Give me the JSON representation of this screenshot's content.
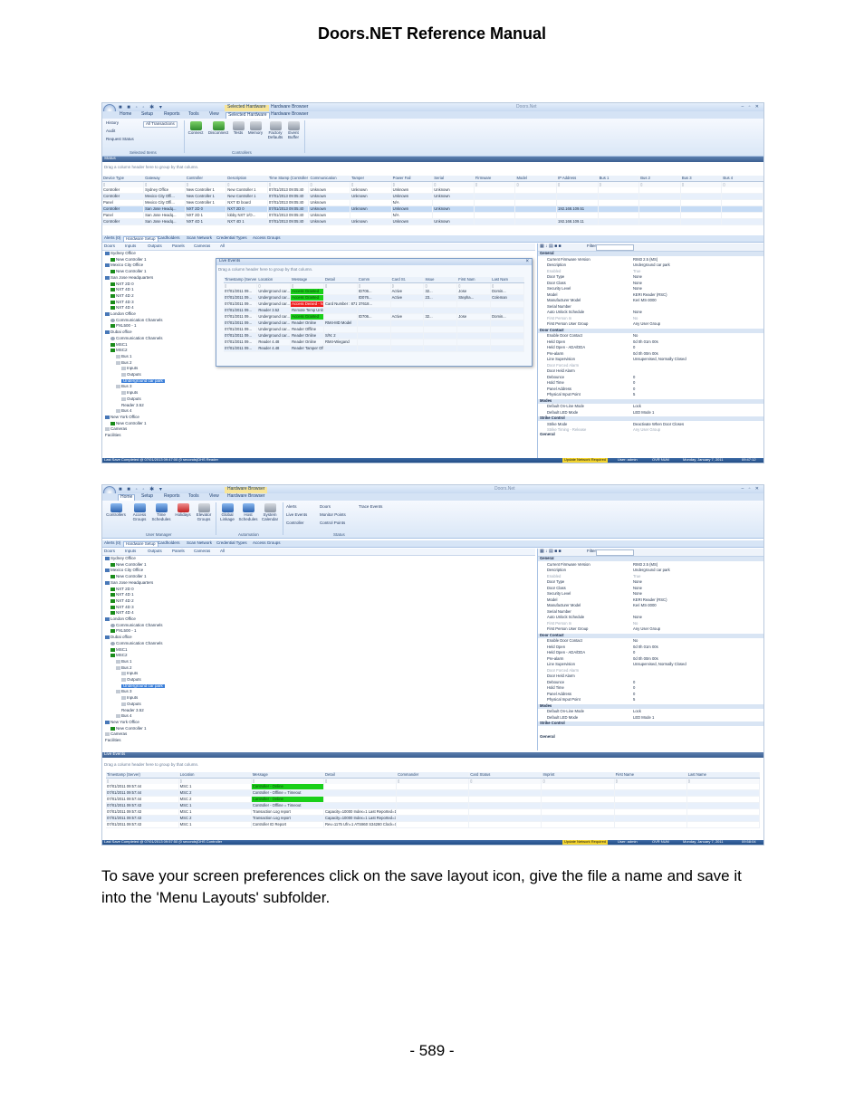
{
  "header": {
    "title": "Doors.NET Reference Manual"
  },
  "caption": "To save your screen preferences click on the save layout icon, give the file a name and save it into the 'Menu Layouts' subfolder.",
  "page_number": "- 589 -",
  "colors": {
    "ribbon_blue": "#d5e3f5",
    "status_blue": "#2c5a95",
    "alarm_green": "#19d019",
    "alarm_red": "#ef1c1c",
    "status_yellow": "#f2d32e"
  },
  "shot1": {
    "titlebar": {
      "ctx_selected": "Selected Hardware",
      "ctx_browser": "Hardware Browser",
      "app_title": "Doors.Net"
    },
    "tabs": [
      "Home",
      "Setup",
      "Reports",
      "Tools",
      "View",
      "Selected Hardware",
      "Hardware Browser"
    ],
    "ribbon": {
      "left_items": [
        "History",
        "Audit",
        "Request Status"
      ],
      "dropdown_value": "All Transactions",
      "buttons": [
        "Connect",
        "Disconnect",
        "Tests",
        "Memory",
        "Factory Defaults",
        "Event Buffer"
      ],
      "group_labels": [
        "Selected Items",
        "Controllers"
      ]
    },
    "status_panel": {
      "title": "Status",
      "group_hint": "Drag a column header here to group by that column.",
      "columns": [
        "Device Type",
        "Gateway",
        "Controller",
        "Description",
        "Time Stamp (Controller)",
        "Communication",
        "Tamper",
        "Power Fail",
        "Serial",
        "Firmware",
        "Model",
        "IP Address",
        "Bus 1",
        "Bus 2",
        "Bus 3",
        "Bus 4"
      ],
      "rows": [
        [
          "Controller",
          "Sydney Office",
          "New Controller 1",
          "New Controller 1",
          "07/01/2013 09:05:40",
          "Unknown",
          "Unknown",
          "Unknown",
          "Unknown",
          "",
          "",
          "",
          "",
          "",
          "",
          ""
        ],
        [
          "Controller",
          "Mexico City Offi...",
          "New Controller 1",
          "New Controller 1",
          "07/01/2013 09:05:40",
          "Unknown",
          "Unknown",
          "Unknown",
          "Unknown",
          "",
          "",
          "",
          "",
          "",
          "",
          ""
        ],
        [
          "Panel",
          "Mexico City Offi...",
          "New Controller 1",
          "NXT ID board",
          "07/01/2013 09:05:40",
          "Unknown",
          "",
          "N/A",
          "",
          "",
          "",
          "",
          "",
          "",
          "",
          ""
        ],
        [
          "Controller",
          "San Jose Headq...",
          "NXT 2D 0",
          "NXT 2D 0",
          "07/01/2013 09:05:40",
          "Unknown",
          "Unknown",
          "Unknown",
          "Unknown",
          "",
          "",
          "192.168.109.51",
          "",
          "",
          "",
          ""
        ],
        [
          "Panel",
          "San Jose Headq...",
          "NXT 2D 1",
          "lobby NXT 1/O...",
          "07/01/2013 09:05:40",
          "Unknown",
          "",
          "N/A",
          "",
          "",
          "",
          "",
          "",
          "",
          "",
          ""
        ],
        [
          "Controller",
          "San Jose Headq...",
          "NXT 4D 1",
          "NXT 4D 1",
          "07/01/2013 09:05:40",
          "Unknown",
          "Unknown",
          "Unknown",
          "Unknown",
          "",
          "",
          "192.168.109.11",
          "",
          "",
          "",
          ""
        ]
      ]
    },
    "nav_tabs": [
      "Alerts (0)",
      "Hardware Setup",
      "Cardholders",
      "Scan Network",
      "Credential Types",
      "Access Groups"
    ],
    "tree_toolbar": [
      "Doors",
      "Inputs",
      "Outputs",
      "Panels",
      "Cameras",
      "All"
    ],
    "tree": [
      {
        "label": "Sydney Office",
        "depth": 0,
        "icon": "building"
      },
      {
        "label": "New Controller 1",
        "depth": 1,
        "icon": "flag"
      },
      {
        "label": "Mexico City Office",
        "depth": 0,
        "icon": "building"
      },
      {
        "label": "New Controller 1",
        "depth": 1,
        "icon": "flag"
      },
      {
        "label": "San Jose Headquarters",
        "depth": 0,
        "icon": "building"
      },
      {
        "label": "NXT 2D 0",
        "depth": 1,
        "icon": "flag"
      },
      {
        "label": "NXT 4D 1",
        "depth": 1,
        "icon": "flag"
      },
      {
        "label": "NXT 4D 2",
        "depth": 1,
        "icon": "flag"
      },
      {
        "label": "NXT 4D 3",
        "depth": 1,
        "icon": "flag"
      },
      {
        "label": "NXT 4D 4",
        "depth": 1,
        "icon": "flag"
      },
      {
        "label": "London Office",
        "depth": 0,
        "icon": "building"
      },
      {
        "label": "Communication Channels",
        "depth": 1,
        "icon": "channel"
      },
      {
        "label": "PXL500 - 1",
        "depth": 1,
        "icon": "flag"
      },
      {
        "label": "Dubai office",
        "depth": 0,
        "icon": "building"
      },
      {
        "label": "Communication Channels",
        "depth": 1,
        "icon": "channel"
      },
      {
        "label": "MSC1",
        "depth": 1,
        "icon": "flag"
      },
      {
        "label": "MSC2",
        "depth": 1,
        "icon": "flag"
      },
      {
        "label": "Bus 1",
        "depth": 2,
        "icon": "dot"
      },
      {
        "label": "Bus 2",
        "depth": 2,
        "icon": "dot"
      },
      {
        "label": "Inputs",
        "depth": 3,
        "icon": "dot"
      },
      {
        "label": "Outputs",
        "depth": 3,
        "icon": "dot"
      },
      {
        "label": "Underground car park",
        "depth": 3,
        "icon": "none",
        "selected": true
      },
      {
        "label": "Bus 3",
        "depth": 2,
        "icon": "dot"
      },
      {
        "label": "Inputs",
        "depth": 3,
        "icon": "dot"
      },
      {
        "label": "Outputs",
        "depth": 3,
        "icon": "dot"
      },
      {
        "label": "Reader 3.52",
        "depth": 3,
        "icon": "none"
      },
      {
        "label": "Bus 4",
        "depth": 2,
        "icon": "dot"
      },
      {
        "label": "New York Office",
        "depth": 0,
        "icon": "building"
      },
      {
        "label": "New Controller 1",
        "depth": 1,
        "icon": "flag"
      },
      {
        "label": "Cameras",
        "depth": 0,
        "icon": "dot"
      },
      {
        "label": "Facilities",
        "depth": 0,
        "icon": "none"
      }
    ],
    "live_events": {
      "title": "Live Events",
      "group_hint": "Drag a column header here to group by that column.",
      "columns": [
        "Timestamp (Server)",
        "Location",
        "Message",
        "Detail",
        "Comm",
        "Card St.",
        "Issue",
        "First Nam",
        "Last Nam"
      ],
      "rows": [
        {
          "cells": [
            "07/01/2011 09...",
            "Underground car...",
            "Access Granted",
            "",
            "ID706...",
            "Active",
            "32...",
            "Jose",
            "Domin..."
          ],
          "msg_color": "green"
        },
        {
          "cells": [
            "07/01/2011 09...",
            "Underground car...",
            "Access Granted",
            "",
            "ID076...",
            "Active",
            "23...",
            "Stepha...",
            "Coleman"
          ],
          "msg_color": "green"
        },
        {
          "cells": [
            "07/01/2011 09...",
            "Underground car...",
            "Access Denied - No Acc...",
            "Card Number : 871...",
            "37618...",
            "",
            "",
            "",
            ""
          ],
          "msg_color": "red"
        },
        {
          "cells": [
            "07/01/2011 09...",
            "Reader 3.52",
            "Remote Temp Unlock - Door use Not Verified",
            "",
            "",
            "",
            "",
            "",
            ""
          ],
          "msg_color": ""
        },
        {
          "cells": [
            "07/01/2011 09...",
            "Underground car...",
            "Access Granted",
            "",
            "ID706...",
            "Active",
            "32...",
            "Jose",
            "Domin..."
          ],
          "msg_color": "green"
        },
        {
          "cells": [
            "07/01/2011 09...",
            "Underground car...",
            "Reader Online",
            "RM4-MD Model",
            "",
            "",
            "",
            "",
            ""
          ],
          "msg_color": ""
        },
        {
          "cells": [
            "07/01/2011 09...",
            "Underground car...",
            "Reader Offline",
            "",
            "",
            "",
            "",
            "",
            ""
          ],
          "msg_color": ""
        },
        {
          "cells": [
            "07/01/2011 09...",
            "Underground car...",
            "Reader Online",
            "S/N: 2",
            "",
            "",
            "",
            "",
            ""
          ],
          "msg_color": ""
        },
        {
          "cells": [
            "07/01/2011 09...",
            "Reader 4.48",
            "Reader Online",
            "RM4-Wiegand",
            "",
            "",
            "",
            "",
            ""
          ],
          "msg_color": ""
        },
        {
          "cells": [
            "07/01/2011 09...",
            "Reader 4.48",
            "Reader Tamper Offline",
            "",
            "",
            "",
            "",
            "",
            ""
          ],
          "msg_color": ""
        }
      ]
    },
    "props_filter_label": "Filter:",
    "properties": [
      {
        "type": "cat",
        "k": "General",
        "v": ""
      },
      {
        "type": "row",
        "k": "Current Firmware Version",
        "v": "RIM3 2.5 (MS)"
      },
      {
        "type": "row",
        "k": "Description",
        "v": "Underground car park"
      },
      {
        "type": "dis",
        "k": "Enabled",
        "v": "True"
      },
      {
        "type": "row",
        "k": "Door Type",
        "v": "None"
      },
      {
        "type": "row",
        "k": "Door Class",
        "v": "None"
      },
      {
        "type": "row",
        "k": "Security Level",
        "v": "None"
      },
      {
        "type": "row",
        "k": "Model",
        "v": "KERI Reader (RSC)"
      },
      {
        "type": "row",
        "k": "Manufacturer Model",
        "v": "Keri MS-3000"
      },
      {
        "type": "row",
        "k": "Serial Number",
        "v": ""
      },
      {
        "type": "row",
        "k": "Auto Unlock Schedule",
        "v": "None"
      },
      {
        "type": "dis",
        "k": "First Person In",
        "v": "No"
      },
      {
        "type": "row",
        "k": "First Person User Group",
        "v": "Any User Group"
      },
      {
        "type": "cat",
        "k": "Door Contact",
        "v": ""
      },
      {
        "type": "row",
        "k": "Enable Door Contact",
        "v": "No"
      },
      {
        "type": "row",
        "k": "Held Open",
        "v": "0d 0h 01m 00s"
      },
      {
        "type": "row",
        "k": "Held Open - ADA/DDA",
        "v": "0"
      },
      {
        "type": "row",
        "k": "Pre-alarm",
        "v": "0d 0h 00m 00s"
      },
      {
        "type": "row",
        "k": "Line Supervision",
        "v": "Unsupervised, Normally Closed"
      },
      {
        "type": "dis",
        "k": "Door Forced Alarm",
        "v": ""
      },
      {
        "type": "row",
        "k": "Door Held Alarm",
        "v": ""
      },
      {
        "type": "row",
        "k": "Debounce",
        "v": "0"
      },
      {
        "type": "row",
        "k": "Hold Time",
        "v": "0"
      },
      {
        "type": "row",
        "k": "Panel Address",
        "v": "0"
      },
      {
        "type": "row",
        "k": "Physical Input Point",
        "v": "5"
      },
      {
        "type": "cat",
        "k": "Modes",
        "v": ""
      },
      {
        "type": "row",
        "k": "Default On-Line Mode",
        "v": "Lock"
      },
      {
        "type": "row",
        "k": "Default LED Mode",
        "v": "LED Mode 1"
      },
      {
        "type": "cat",
        "k": "Strike Control",
        "v": ""
      },
      {
        "type": "row",
        "k": "Strike Mode",
        "v": "Deactivate When Door Closes"
      },
      {
        "type": "dis",
        "k": "Strike Timing - Release",
        "v": "Any User Group"
      }
    ],
    "props_desc_label": "General",
    "status_bar": {
      "left": "Last Save Completed @ 07/01/2013 09:47:00 (0 seconds)DHS Reader",
      "yellow": "Update Network Required",
      "user": "User: admin",
      "ovr": "OVR NUM",
      "date": "Monday, January 7, 2011",
      "time": "09:47:12"
    }
  },
  "shot2": {
    "titlebar": {
      "ctx_browser": "Hardware Browser",
      "app_title": "Doors.Net"
    },
    "tabs": [
      "Home",
      "Setup",
      "Reports",
      "Tools",
      "View",
      "Hardware Browser"
    ],
    "ribbon": {
      "buttons": [
        "Controllers",
        "Access Groups",
        "Time Schedules",
        "Holidays",
        "Elevator Groups",
        "Global Linkage",
        "Host Schedules",
        "System Calendar"
      ],
      "small_items": [
        "Alerts",
        "Live Events",
        "Controller",
        "Doors",
        "Monitor Points",
        "Control Points",
        "Trace Events"
      ],
      "group_labels": [
        "User Manager",
        "Automation",
        "Status"
      ]
    },
    "nav_tabs": [
      "Alerts (0)",
      "Hardware Setup",
      "Cardholders",
      "Scan Network",
      "Credential Types",
      "Access Groups"
    ],
    "live_events_panel": {
      "title": "Live Events",
      "group_hint": "Drag a column header here to group by that column.",
      "columns": [
        "Timestamp (Server)",
        "Location",
        "Message",
        "Detail",
        "Commander",
        "Card Status",
        "Imprint",
        "First Name",
        "Last Name"
      ],
      "rows": [
        {
          "cells": [
            "07/01/2011 09:57:44",
            "MSC 1",
            "Controller - Online",
            "",
            "",
            "",
            "",
            "",
            ""
          ],
          "msg_color": "green"
        },
        {
          "cells": [
            "07/01/2011 09:57:44",
            "MSC 2",
            "Controller - Offline = Timeout",
            "",
            "",
            "",
            "",
            "",
            ""
          ],
          "msg_color": ""
        },
        {
          "cells": [
            "07/01/2011 09:57:44",
            "MSC 2",
            "Controller - Online",
            "",
            "",
            "",
            "",
            "",
            ""
          ],
          "msg_color": "green"
        },
        {
          "cells": [
            "07/01/2011 09:57:43",
            "MSC 1",
            "Controller - Offline = Timeout",
            "",
            "",
            "",
            "",
            "",
            ""
          ],
          "msg_color": ""
        },
        {
          "cells": [
            "07/01/2011 09:57:43",
            "MSC 1",
            "Transaction Log report",
            "Capacity=10000 Index=1 Last Reported=127...",
            "",
            "",
            "",
            "",
            ""
          ],
          "msg_color": ""
        },
        {
          "cells": [
            "07/01/2011 09:57:43",
            "MSC 2",
            "Transaction Log report",
            "Capacity=10000 Index=1 Last Reported=311...",
            "",
            "",
            "",
            "",
            ""
          ],
          "msg_color": ""
        },
        {
          "cells": [
            "07/01/2011 09:57:43",
            "MSC 1",
            "Controller ID Report",
            "Rev=1175 Ufn=1 ATS860 S34280 Clock=ST...",
            "",
            "",
            "",
            "",
            ""
          ],
          "msg_color": ""
        }
      ]
    },
    "status_bar": {
      "left": "Last Save Completed @ 07/01/2013 09:57:50 (0 seconds)DHS Controller",
      "yellow": "Update Network Required",
      "user": "User: admin",
      "ovr": "OVR NUM",
      "date": "Monday, January 7, 2011",
      "time": "09:58:04"
    }
  }
}
